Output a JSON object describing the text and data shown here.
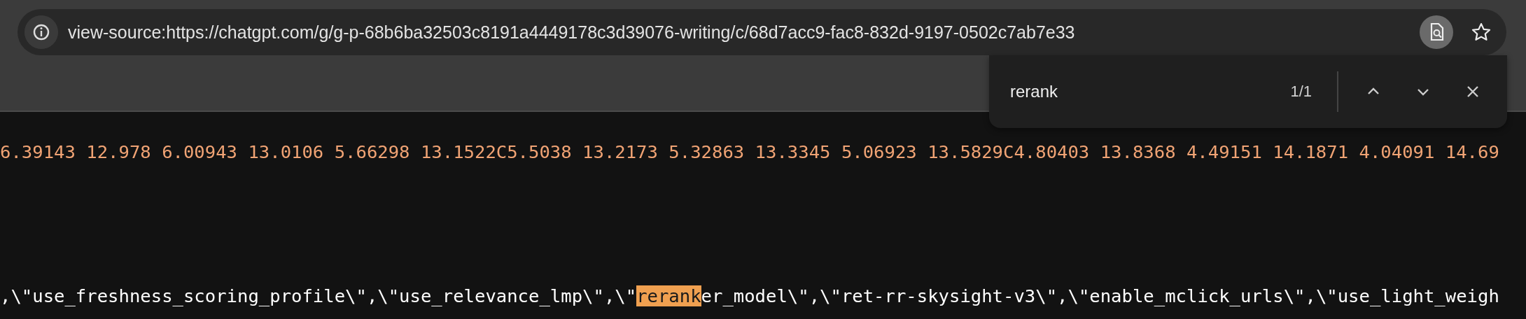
{
  "address_bar": {
    "url": "view-source:https://chatgpt.com/g/g-p-68b6ba32503c8191a4449178c3d39076-writing/c/68d7acc9-fac8-832d-9197-0502c7ab7e33",
    "page_search_active": true
  },
  "find_bar": {
    "query": "rerank",
    "count": "1/1"
  },
  "source_lines": [
    {
      "kind": "number",
      "segments": [
        {
          "text": "6.39143 12.978 6.00943 13.0106 5.66298 13.1522C5.5038 13.2173 5.32863 13.3345 5.06923 13.5829C4.80403 13.8368 4.49151 14.1871 4.04091 14.69",
          "highlighted": false
        }
      ]
    },
    {
      "kind": "string",
      "segments": [
        {
          "text": ",\\\"use_freshness_scoring_profile\\\",\\\"use_relevance_lmp\\\",\\\"",
          "highlighted": false
        },
        {
          "text": "rerank",
          "highlighted": true
        },
        {
          "text": "er_model\\\",\\\"ret-rr-skysight-v3\\\",\\\"enable_mclick_urls\\\",\\\"use_light_weigh",
          "highlighted": false
        }
      ]
    }
  ]
}
